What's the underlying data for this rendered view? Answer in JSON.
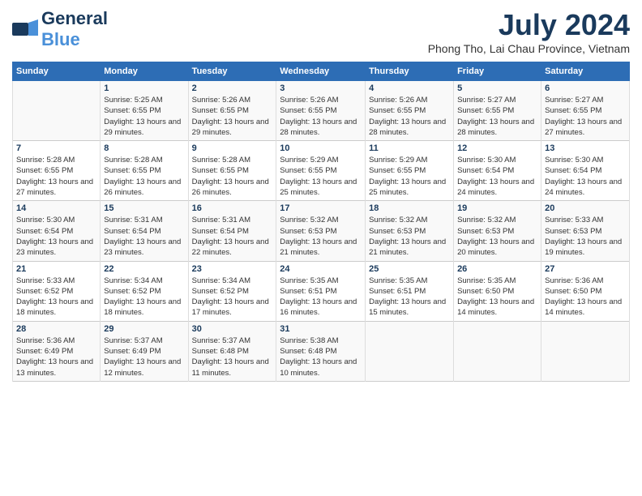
{
  "header": {
    "logo_general": "General",
    "logo_blue": "Blue",
    "month_title": "July 2024",
    "location": "Phong Tho, Lai Chau Province, Vietnam"
  },
  "days_of_week": [
    "Sunday",
    "Monday",
    "Tuesday",
    "Wednesday",
    "Thursday",
    "Friday",
    "Saturday"
  ],
  "weeks": [
    {
      "cells": [
        {
          "day": "",
          "info": ""
        },
        {
          "day": "1",
          "info": "Sunrise: 5:25 AM\nSunset: 6:55 PM\nDaylight: 13 hours\nand 29 minutes."
        },
        {
          "day": "2",
          "info": "Sunrise: 5:26 AM\nSunset: 6:55 PM\nDaylight: 13 hours\nand 29 minutes."
        },
        {
          "day": "3",
          "info": "Sunrise: 5:26 AM\nSunset: 6:55 PM\nDaylight: 13 hours\nand 28 minutes."
        },
        {
          "day": "4",
          "info": "Sunrise: 5:26 AM\nSunset: 6:55 PM\nDaylight: 13 hours\nand 28 minutes."
        },
        {
          "day": "5",
          "info": "Sunrise: 5:27 AM\nSunset: 6:55 PM\nDaylight: 13 hours\nand 28 minutes."
        },
        {
          "day": "6",
          "info": "Sunrise: 5:27 AM\nSunset: 6:55 PM\nDaylight: 13 hours\nand 27 minutes."
        }
      ]
    },
    {
      "cells": [
        {
          "day": "7",
          "info": "Sunrise: 5:28 AM\nSunset: 6:55 PM\nDaylight: 13 hours\nand 27 minutes."
        },
        {
          "day": "8",
          "info": "Sunrise: 5:28 AM\nSunset: 6:55 PM\nDaylight: 13 hours\nand 26 minutes."
        },
        {
          "day": "9",
          "info": "Sunrise: 5:28 AM\nSunset: 6:55 PM\nDaylight: 13 hours\nand 26 minutes."
        },
        {
          "day": "10",
          "info": "Sunrise: 5:29 AM\nSunset: 6:55 PM\nDaylight: 13 hours\nand 25 minutes."
        },
        {
          "day": "11",
          "info": "Sunrise: 5:29 AM\nSunset: 6:55 PM\nDaylight: 13 hours\nand 25 minutes."
        },
        {
          "day": "12",
          "info": "Sunrise: 5:30 AM\nSunset: 6:54 PM\nDaylight: 13 hours\nand 24 minutes."
        },
        {
          "day": "13",
          "info": "Sunrise: 5:30 AM\nSunset: 6:54 PM\nDaylight: 13 hours\nand 24 minutes."
        }
      ]
    },
    {
      "cells": [
        {
          "day": "14",
          "info": "Sunrise: 5:30 AM\nSunset: 6:54 PM\nDaylight: 13 hours\nand 23 minutes."
        },
        {
          "day": "15",
          "info": "Sunrise: 5:31 AM\nSunset: 6:54 PM\nDaylight: 13 hours\nand 23 minutes."
        },
        {
          "day": "16",
          "info": "Sunrise: 5:31 AM\nSunset: 6:54 PM\nDaylight: 13 hours\nand 22 minutes."
        },
        {
          "day": "17",
          "info": "Sunrise: 5:32 AM\nSunset: 6:53 PM\nDaylight: 13 hours\nand 21 minutes."
        },
        {
          "day": "18",
          "info": "Sunrise: 5:32 AM\nSunset: 6:53 PM\nDaylight: 13 hours\nand 21 minutes."
        },
        {
          "day": "19",
          "info": "Sunrise: 5:32 AM\nSunset: 6:53 PM\nDaylight: 13 hours\nand 20 minutes."
        },
        {
          "day": "20",
          "info": "Sunrise: 5:33 AM\nSunset: 6:53 PM\nDaylight: 13 hours\nand 19 minutes."
        }
      ]
    },
    {
      "cells": [
        {
          "day": "21",
          "info": "Sunrise: 5:33 AM\nSunset: 6:52 PM\nDaylight: 13 hours\nand 18 minutes."
        },
        {
          "day": "22",
          "info": "Sunrise: 5:34 AM\nSunset: 6:52 PM\nDaylight: 13 hours\nand 18 minutes."
        },
        {
          "day": "23",
          "info": "Sunrise: 5:34 AM\nSunset: 6:52 PM\nDaylight: 13 hours\nand 17 minutes."
        },
        {
          "day": "24",
          "info": "Sunrise: 5:35 AM\nSunset: 6:51 PM\nDaylight: 13 hours\nand 16 minutes."
        },
        {
          "day": "25",
          "info": "Sunrise: 5:35 AM\nSunset: 6:51 PM\nDaylight: 13 hours\nand 15 minutes."
        },
        {
          "day": "26",
          "info": "Sunrise: 5:35 AM\nSunset: 6:50 PM\nDaylight: 13 hours\nand 14 minutes."
        },
        {
          "day": "27",
          "info": "Sunrise: 5:36 AM\nSunset: 6:50 PM\nDaylight: 13 hours\nand 14 minutes."
        }
      ]
    },
    {
      "cells": [
        {
          "day": "28",
          "info": "Sunrise: 5:36 AM\nSunset: 6:49 PM\nDaylight: 13 hours\nand 13 minutes."
        },
        {
          "day": "29",
          "info": "Sunrise: 5:37 AM\nSunset: 6:49 PM\nDaylight: 13 hours\nand 12 minutes."
        },
        {
          "day": "30",
          "info": "Sunrise: 5:37 AM\nSunset: 6:48 PM\nDaylight: 13 hours\nand 11 minutes."
        },
        {
          "day": "31",
          "info": "Sunrise: 5:38 AM\nSunset: 6:48 PM\nDaylight: 13 hours\nand 10 minutes."
        },
        {
          "day": "",
          "info": ""
        },
        {
          "day": "",
          "info": ""
        },
        {
          "day": "",
          "info": ""
        }
      ]
    }
  ]
}
